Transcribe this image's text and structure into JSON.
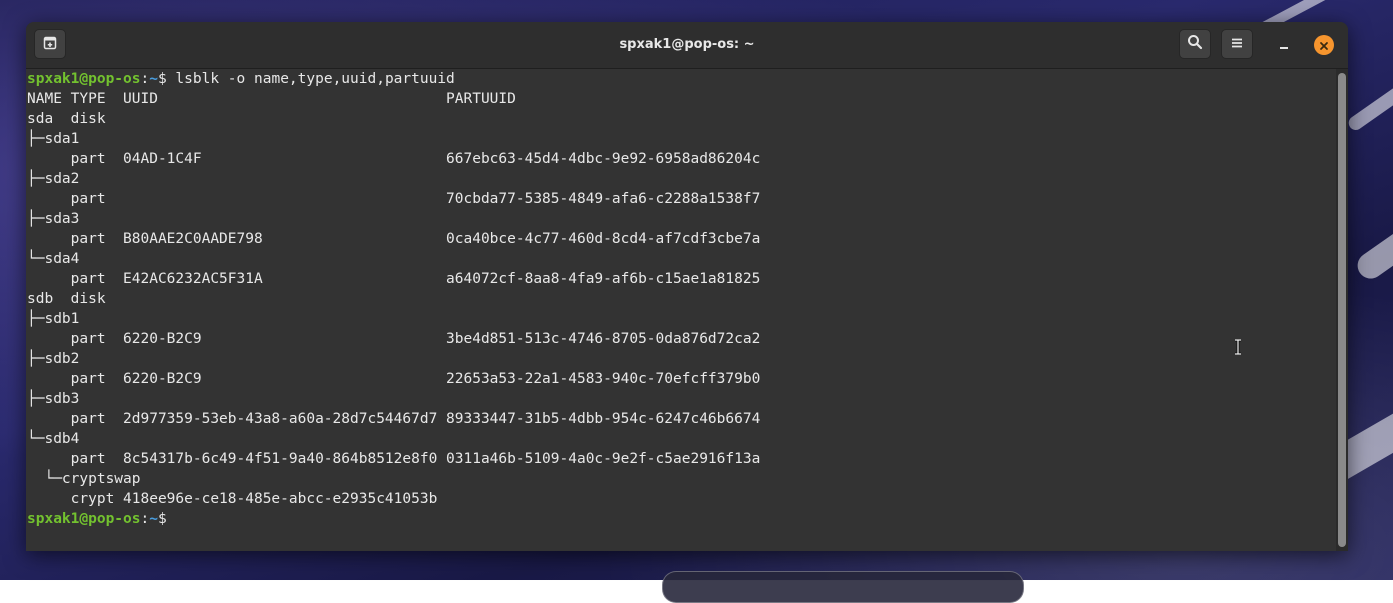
{
  "window": {
    "title": "spxak1@pop-os: ~"
  },
  "titlebar_icons": {
    "new_tab": "new-tab-icon",
    "search": "search-icon",
    "menu": "hamburger-menu-icon",
    "minimize": "minimize-icon",
    "close": "close-icon"
  },
  "colors": {
    "prompt_user": "#73c22f",
    "prompt_path": "#4a9ee0",
    "terminal_bg": "#333333",
    "text": "#e8e8e8",
    "close_button": "#f6952e"
  },
  "prompt": {
    "user_host": "spxak1@pop-os",
    "colon": ":",
    "path": "~",
    "dollar": "$"
  },
  "command": " lsblk -o name,type,uuid,partuuid",
  "output": [
    "NAME TYPE  UUID                                 PARTUUID",
    "sda  disk",
    "├─sda1",
    "     part  04AD-1C4F                            667ebc63-45d4-4dbc-9e92-6958ad86204c",
    "├─sda2",
    "     part                                       70cbda77-5385-4849-afa6-c2288a1538f7",
    "├─sda3",
    "     part  B80AAE2C0AADE798                     0ca40bce-4c77-460d-8cd4-af7cdf3cbe7a",
    "└─sda4",
    "     part  E42AC6232AC5F31A                     a64072cf-8aa8-4fa9-af6b-c15ae1a81825",
    "sdb  disk",
    "├─sdb1",
    "     part  6220-B2C9                            3be4d851-513c-4746-8705-0da876d72ca2",
    "├─sdb2",
    "     part  6220-B2C9                            22653a53-22a1-4583-940c-70efcff379b0",
    "├─sdb3",
    "     part  2d977359-53eb-43a8-a60a-28d7c54467d7 89333447-31b5-4dbb-954c-6247c46b6674",
    "└─sdb4",
    "     part  8c54317b-6c49-4f51-9a40-864b8512e8f0 0311a46b-5109-4a0c-9e2f-c5ae2916f13a",
    "  └─cryptswap",
    "     crypt 418ee96e-ce18-485e-abcc-e2935c41053b"
  ]
}
